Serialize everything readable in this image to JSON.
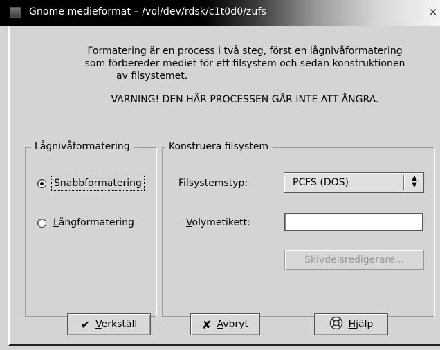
{
  "window": {
    "title": "Gnome medieformat – /vol/dev/rdsk/c1t0d0/zufs",
    "close_glyph": "×"
  },
  "message": {
    "intro_line1": "Formatering är en process i två steg, först en lågnivåformatering",
    "intro_line2": "som förbereder mediet för ett filsystem och sedan konstruktionen",
    "intro_line3": "av filsystemet.",
    "warning": "VARNING! DEN HÄR PROCESSEN GÅR INTE ATT ÅNGRA."
  },
  "low_level": {
    "title": "Lågnivåformatering",
    "options": [
      {
        "mnemonic": "S",
        "rest": "nabbformatering",
        "selected": true
      },
      {
        "mnemonic": "L",
        "rest": "ångformatering",
        "selected": false
      }
    ]
  },
  "filesystem": {
    "title": "Konstruera filsystem",
    "type_mnemonic": "F",
    "type_rest": "ilsystemstyp:",
    "type_value": "PCFS (DOS)",
    "label_mnemonic": "V",
    "label_rest": "olymetikett:",
    "label_value": "",
    "partition_editor": "Skivdelsredigerare..."
  },
  "buttons": {
    "apply_mnemonic": "V",
    "apply_rest": "erkställ",
    "cancel_mnemonic": "A",
    "cancel_rest": "vbryt",
    "help_mnemonic": "H",
    "help_rest": "jälp"
  },
  "icons": {
    "apply": "checkmark-icon",
    "cancel": "x-icon",
    "help": "lifebuoy-icon",
    "combo_arrows": "up-down-arrows-icon"
  }
}
